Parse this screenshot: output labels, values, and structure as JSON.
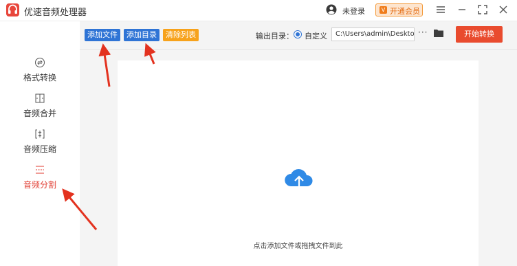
{
  "app": {
    "title": "优速音频处理器"
  },
  "header": {
    "user_status": "未登录",
    "vip_label": "开通会员",
    "vip_badge": "V"
  },
  "sidebar": {
    "items": [
      {
        "label": "格式转换",
        "icon": "format-convert-icon",
        "active": false
      },
      {
        "label": "音频合并",
        "icon": "merge-icon",
        "active": false
      },
      {
        "label": "音频压缩",
        "icon": "compress-icon",
        "active": false
      },
      {
        "label": "音频分割",
        "icon": "split-icon",
        "active": true
      }
    ]
  },
  "toolbar": {
    "add_file": "添加文件",
    "add_folder": "添加目录",
    "clear_list": "清除列表",
    "output_label": "输出目录：",
    "custom_option": "自定义",
    "output_path": "C:\\Users\\admin\\Deskto",
    "more": "···",
    "start": "开始转换"
  },
  "dropzone": {
    "hint": "点击添加文件或拖拽文件到此"
  },
  "colors": {
    "accent_red": "#e94b2e",
    "active_red": "#e03a2f",
    "button_blue": "#2f74d5",
    "button_orange": "#f7a21b",
    "annotation_arrow": "#e3321f"
  }
}
